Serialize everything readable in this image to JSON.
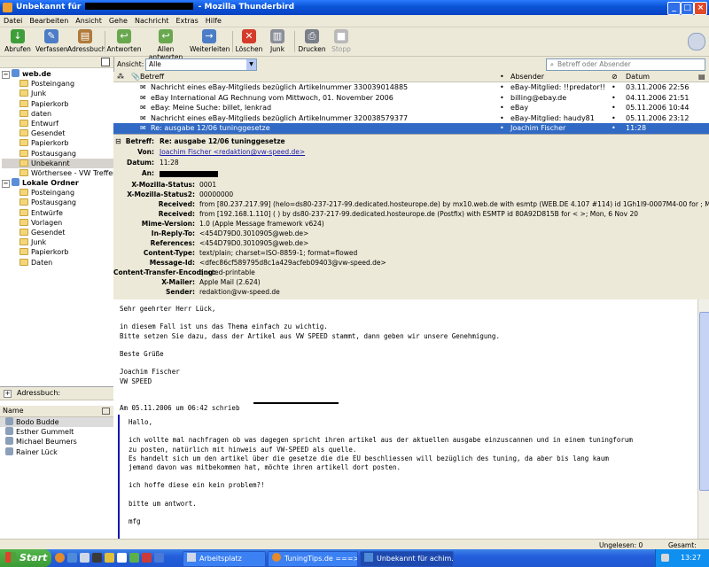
{
  "window": {
    "title_prefix": "Unbekannt für",
    "title_suffix": "- Mozilla Thunderbird",
    "min_label": "_",
    "max_label": "□",
    "close_label": "×"
  },
  "menu": [
    "Datei",
    "Bearbeiten",
    "Ansicht",
    "Gehe",
    "Nachricht",
    "Extras",
    "Hilfe"
  ],
  "toolbar": {
    "buttons": [
      {
        "label": "Abrufen",
        "icon": "download-icon",
        "color": "#3f9d3a"
      },
      {
        "label": "Verfassen",
        "icon": "compose-icon",
        "color": "#4c7dc6"
      },
      {
        "label": "Adressbuch",
        "icon": "addressbook-icon",
        "color": "#b07a3a"
      },
      {
        "label": "Antworten",
        "icon": "reply-icon",
        "color": "#6aa84f"
      },
      {
        "label": "Allen antworten",
        "icon": "reply-all-icon",
        "color": "#6aa84f"
      },
      {
        "label": "Weiterleiten",
        "icon": "forward-icon",
        "color": "#4c7dc6"
      },
      {
        "label": "Löschen",
        "icon": "delete-icon",
        "color": "#d43b2a"
      },
      {
        "label": "Junk",
        "icon": "junk-icon",
        "color": "#8a8f99"
      },
      {
        "label": "Drucken",
        "icon": "print-icon",
        "color": "#7a7f88"
      },
      {
        "label": "Stopp",
        "icon": "stop-icon",
        "color": "#b9b9b9"
      }
    ]
  },
  "filter": {
    "label": "Ansicht:",
    "value": "Alle",
    "search_placeholder": "Betreff oder Absender"
  },
  "folders": {
    "account1": "web.de",
    "account1_items": [
      "Posteingang",
      "Junk",
      "Papierkorb",
      "daten",
      "Entwurf",
      "Gesendet",
      "Papierkorb",
      "Postausgang",
      "Unbekannt",
      "Wörthersee - VW Treffen"
    ],
    "account2": "Lokale Ordner",
    "account2_items": [
      "Posteingang",
      "Postausgang",
      "Entwürfe",
      "Vorlagen",
      "Gesendet",
      "Junk",
      "Papierkorb",
      "Daten"
    ]
  },
  "addressbook": {
    "title": "Adressbuch:",
    "column": "Name",
    "contacts": [
      "Bodo Budde",
      "Esther Gummelt",
      "Michael Beumers",
      "Rainer Lück"
    ]
  },
  "messages": {
    "columns": {
      "subject": "Betreff",
      "sender": "Absender",
      "date": "Datum"
    },
    "rows": [
      {
        "subject": "Nachricht eines eBay-Mitglieds bezüglich Artikelnummer 330039014885",
        "sender": "eBay-Mitglied: !!predator!!",
        "date": "03.11.2006 22:56"
      },
      {
        "subject": "eBay International AG Rechnung vom Mittwoch, 01. November 2006",
        "sender": "billing@ebay.de",
        "date": "04.11.2006 21:51"
      },
      {
        "subject": "eBay: Meine Suche: billet, lenkrad",
        "sender": "eBay",
        "date": "05.11.2006 10:44"
      },
      {
        "subject": "Nachricht eines eBay-Mitglieds bezüglich Artikelnummer 320038579377",
        "sender": "eBay-Mitglied: haudy81",
        "date": "05.11.2006 23:12"
      },
      {
        "subject": "Re: ausgabe 12/06 tuninggesetze",
        "sender": "Joachim Fischer",
        "date": "11:28",
        "selected": true
      }
    ]
  },
  "headers": {
    "subject_key": "Betreff:",
    "subject": "Re: ausgabe 12/06 tuninggesetze",
    "from_key": "Von:",
    "from": "Joachim Fischer <redaktion@vw-speed.de>",
    "date_key": "Datum:",
    "date": "11:28",
    "to_key": "An:",
    "rows": [
      {
        "k": "X-Mozilla-Status:",
        "v": "0001"
      },
      {
        "k": "X-Mozilla-Status2:",
        "v": "00000000"
      },
      {
        "k": "Received:",
        "v": "from [80.237.217.99] (helo=ds80-237-217-99.dedicated.hosteurope.de)     by mx10.web.de with esmtp (WEB.DE 4.107 #114)   id 1Gh1I9-0007M4-00     for                         ; Mon, 06 Nov 2006 11:2"
      },
      {
        "k": "Received:",
        "v": "from [192.168.1.110] (                                             )     by ds80-237-217-99.dedicated.hosteurope.de (Postfix) with ESMTP id 80A92D815B   for <                          >; Mon, 6 Nov 20"
      },
      {
        "k": "Mime-Version:",
        "v": "1.0 (Apple Message framework v624)"
      },
      {
        "k": "In-Reply-To:",
        "v": "<454D79D0.3010905@web.de>"
      },
      {
        "k": "References:",
        "v": "<454D79D0.3010905@web.de>"
      },
      {
        "k": "Content-Type:",
        "v": "text/plain; charset=ISO-8859-1; format=flowed"
      },
      {
        "k": "Message-Id:",
        "v": "<dfec86cf589795d8c1a429acfeb09403@vw-speed.de>"
      },
      {
        "k": "Content-Transfer-Encoding:",
        "v": "quoted-printable"
      },
      {
        "k": "X-Mailer:",
        "v": "Apple Mail (2.624)"
      },
      {
        "k": "Sender:",
        "v": "redaktion@vw-speed.de"
      }
    ]
  },
  "body": {
    "lines": [
      "Sehr geehrter Herr Lück,",
      "",
      "in diesem Fall ist uns das Thema einfach zu wichtig.",
      "Bitte setzen Sie dazu, dass der Artikel aus VW SPEED stammt, dann geben wir unsere Genehmigung.",
      "",
      "Beste Grüße",
      "",
      "Joachim Fischer",
      "VW SPEED",
      "",
      "",
      "Am 05.11.2006 um 06:42 schrieb"
    ],
    "quote": [
      "Hallo,",
      "",
      "ich wollte mal nachfragen ob was dagegen spricht ihren artikel aus der aktuellen ausgabe einzuscannen und in einem tuningforum",
      "zu posten, natürlich mit hinweis auf VW-SPEED als quelle.",
      "Es handelt sich um den artikel über die gesetze die die EU beschliessen will bezüglich des tuning, da aber bis lang kaum",
      "jemand davon was mitbekommen hat, möchte ihren artikell dort posten.",
      "",
      "ich hoffe diese ein kein problem?!",
      "",
      "bitte um antwort.",
      "",
      "mfg"
    ]
  },
  "status": {
    "unread": "Ungelesen: 0",
    "total": "Gesamt: 211"
  },
  "taskbar": {
    "start": "Start",
    "tasks": [
      "Arbeitsplatz",
      "TuningTips.de ===>...",
      "Unbekannt für achim..."
    ],
    "clock": "13:27"
  }
}
